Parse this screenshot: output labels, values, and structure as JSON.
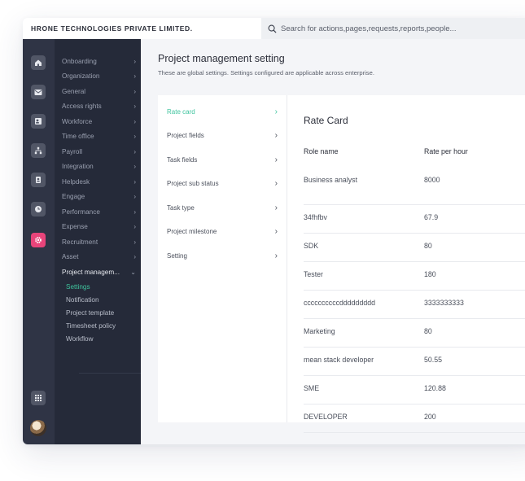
{
  "company": "HRONE TECHNOLOGIES PRIVATE LIMITED.",
  "search": {
    "placeholder": "Search for actions,pages,requests,reports,people..."
  },
  "rail": {
    "icons": [
      "home-icon",
      "mail-icon",
      "contacts-icon",
      "org-chart-icon",
      "user-badge-icon",
      "clock-icon",
      "settings-gear-icon"
    ],
    "bottom_icons": [
      "apps-grid-icon",
      "user-avatar"
    ],
    "active_color": "#e8447a"
  },
  "menu": {
    "items": [
      {
        "label": "Onboarding"
      },
      {
        "label": "Organization"
      },
      {
        "label": "General"
      },
      {
        "label": "Access rights"
      },
      {
        "label": "Workforce"
      },
      {
        "label": "Time office"
      },
      {
        "label": "Payroll"
      },
      {
        "label": "Integration"
      },
      {
        "label": "Helpdesk"
      },
      {
        "label": "Engage"
      },
      {
        "label": "Performance"
      },
      {
        "label": "Expense"
      },
      {
        "label": "Recruitment"
      },
      {
        "label": "Asset"
      },
      {
        "label": "Project managem..."
      }
    ],
    "sub_items": [
      {
        "label": "Settings"
      },
      {
        "label": "Notification"
      },
      {
        "label": "Project template"
      },
      {
        "label": "Timesheet policy"
      },
      {
        "label": "Workflow"
      }
    ]
  },
  "page": {
    "title": "Project management setting",
    "subtitle": "These are global settings. Settings configured are applicable across enterprise."
  },
  "settings_nav": [
    {
      "label": "Rate card"
    },
    {
      "label": "Project fields"
    },
    {
      "label": "Task fields"
    },
    {
      "label": "Project sub status"
    },
    {
      "label": "Task type"
    },
    {
      "label": "Project milestone"
    },
    {
      "label": "Setting"
    }
  ],
  "rate_card": {
    "title": "Rate Card",
    "col_role": "Role name",
    "col_rate": "Rate per hour",
    "rows": [
      {
        "role": "Business analyst",
        "rate": "8000"
      },
      {
        "role": "34fhfbv",
        "rate": "67.9"
      },
      {
        "role": "SDK",
        "rate": "80"
      },
      {
        "role": "Tester",
        "rate": "180"
      },
      {
        "role": "ccccccccccddddddddd",
        "rate": "3333333333"
      },
      {
        "role": "Marketing",
        "rate": "80"
      },
      {
        "role": "mean stack developer",
        "rate": "50.55"
      },
      {
        "role": "SME",
        "rate": "120.88"
      },
      {
        "role": "DEVELOPER",
        "rate": "200"
      }
    ]
  },
  "accent_color": "#3fc49e"
}
